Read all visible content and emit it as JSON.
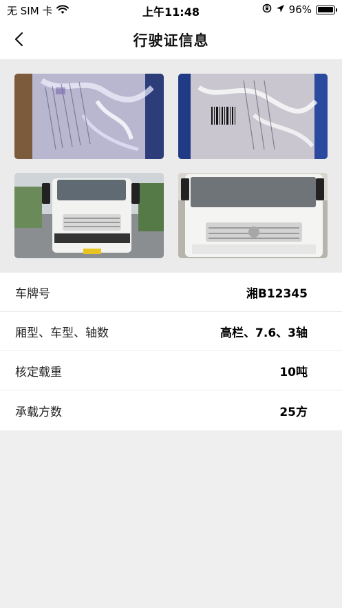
{
  "status_bar": {
    "carrier": "无 SIM 卡",
    "time": "上午11:48",
    "battery": "96%",
    "battery_level": 0.96
  },
  "header": {
    "title": "行驶证信息",
    "back_icon": "chevron-left-icon"
  },
  "photos": [
    {
      "name": "license-photo-1"
    },
    {
      "name": "license-photo-2"
    },
    {
      "name": "truck-photo-front-1"
    },
    {
      "name": "truck-photo-front-2"
    }
  ],
  "info": {
    "rows": [
      {
        "label": "车牌号",
        "value": "湘B12345"
      },
      {
        "label": "厢型、车型、轴数",
        "value": "高栏、7.6、3轴"
      },
      {
        "label": "核定载重",
        "value": "10吨"
      },
      {
        "label": "承载方数",
        "value": "25方"
      }
    ]
  }
}
